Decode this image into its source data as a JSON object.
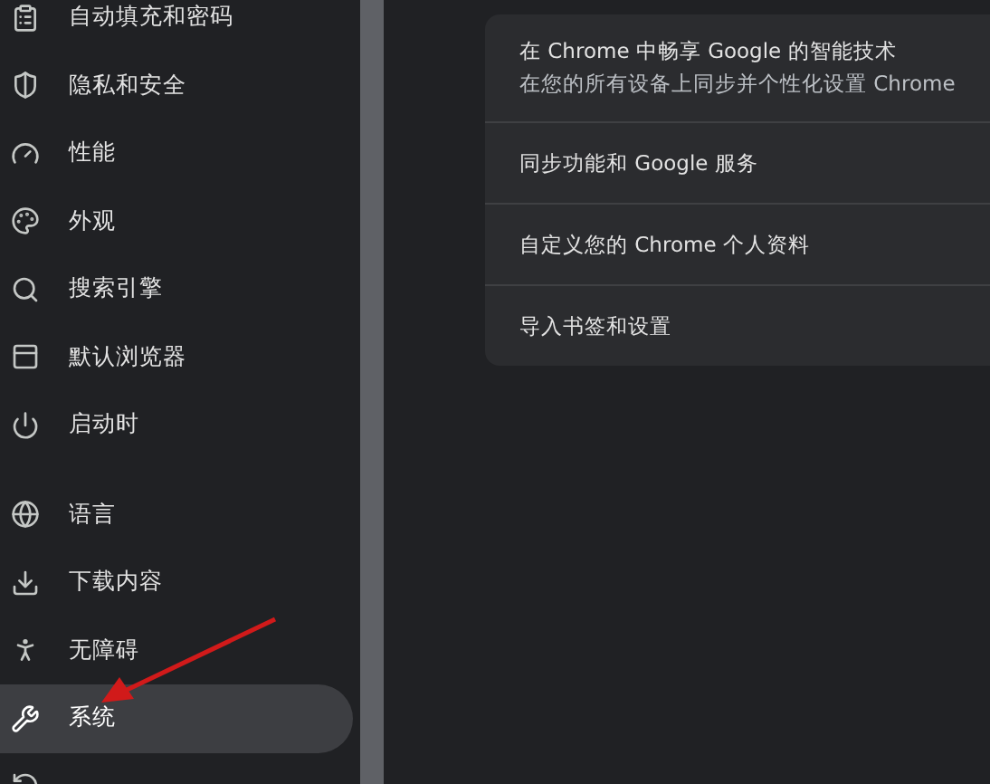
{
  "sidebar": {
    "groups": [
      [
        {
          "kind": "autofill",
          "label": "自动填充和密码",
          "selected": false
        },
        {
          "kind": "privacy",
          "label": "隐私和安全",
          "selected": false
        },
        {
          "kind": "performance",
          "label": "性能",
          "selected": false
        },
        {
          "kind": "appearance",
          "label": "外观",
          "selected": false
        },
        {
          "kind": "search",
          "label": "搜索引擎",
          "selected": false
        },
        {
          "kind": "browser",
          "label": "默认浏览器",
          "selected": false
        },
        {
          "kind": "startup",
          "label": "启动时",
          "selected": false
        }
      ],
      [
        {
          "kind": "language",
          "label": "语言",
          "selected": false
        },
        {
          "kind": "download",
          "label": "下载内容",
          "selected": false
        },
        {
          "kind": "accessibility",
          "label": "无障碍",
          "selected": false
        },
        {
          "kind": "system",
          "label": "系统",
          "selected": true
        },
        {
          "kind": "reset",
          "selected": false
        }
      ]
    ]
  },
  "card": {
    "rows": [
      {
        "title": "在 Chrome 中畅享 Google 的智能技术",
        "subtitle": "在您的所有设备上同步并个性化设置 Chrome"
      },
      {
        "title": "同步功能和 Google 服务"
      },
      {
        "title": "自定义您的 Chrome 个人资料"
      },
      {
        "title": "导入书签和设置"
      }
    ]
  }
}
